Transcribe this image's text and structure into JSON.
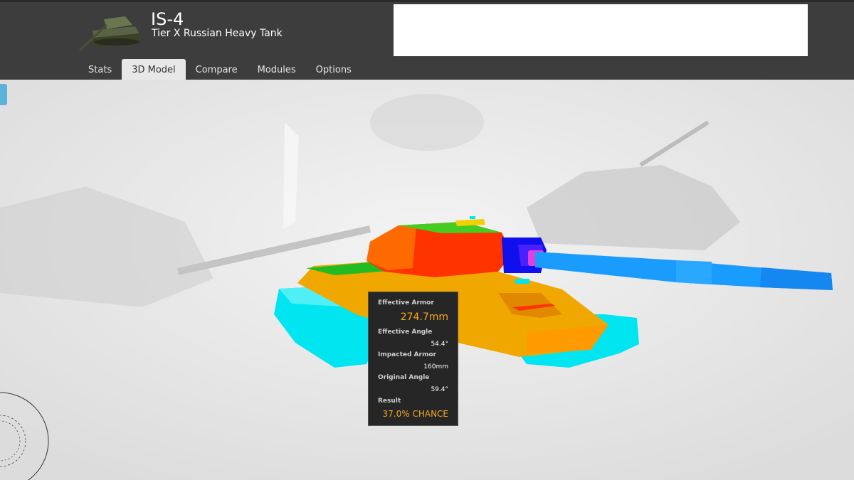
{
  "header": {
    "tank_name": "IS-4",
    "tank_subtitle": "Tier X Russian Heavy Tank"
  },
  "tabs": [
    {
      "label": "Stats",
      "active": false
    },
    {
      "label": "3D Model",
      "active": true
    },
    {
      "label": "Compare",
      "active": false
    },
    {
      "label": "Modules",
      "active": false
    },
    {
      "label": "Options",
      "active": false
    }
  ],
  "tooltip": {
    "effective_armor_label": "Effective Armor",
    "effective_armor_value": "274.7mm",
    "effective_angle_label": "Effective Angle",
    "effective_angle_value": "54.4°",
    "impacted_armor_label": "Impacted Armor",
    "impacted_armor_value": "160mm",
    "original_angle_label": "Original Angle",
    "original_angle_value": "59.4°",
    "result_label": "Result",
    "result_value": "37.0% CHANCE"
  },
  "colors": {
    "header_bg": "#3d3d3d",
    "accent_orange": "#f5a623",
    "armor_cyan": "#00e5ef",
    "armor_yellow": "#f0a800",
    "armor_red": "#ff3300",
    "armor_blue": "#1010ee",
    "gun_blue": "#1a9cff"
  },
  "icons": {
    "tank_thumbnail": "tank-thumbnail-icon",
    "side_handle": "panel-handle-icon"
  }
}
